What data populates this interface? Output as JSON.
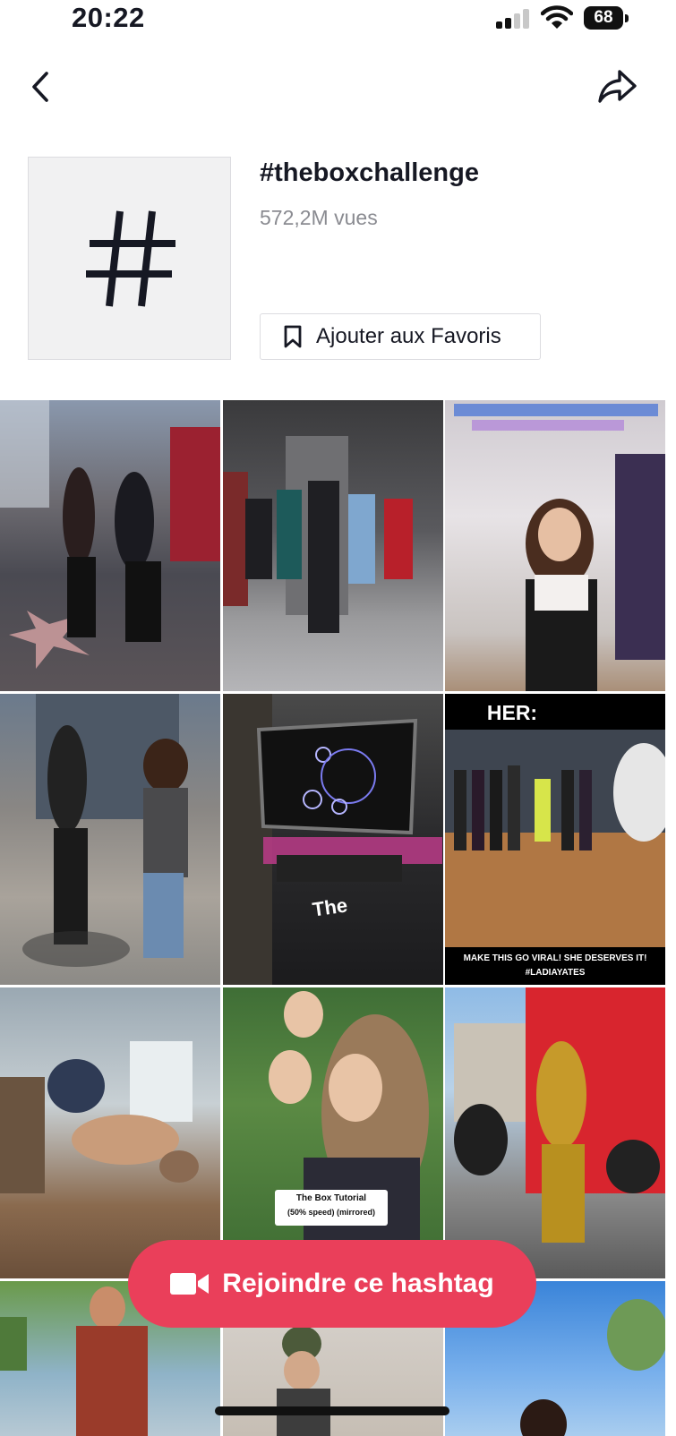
{
  "status_bar": {
    "time": "20:22",
    "battery": "68"
  },
  "nav": {
    "back_icon": "chevron-left-icon",
    "share_icon": "share-arrow-icon"
  },
  "hashtag": {
    "name": "#theboxchallenge",
    "views": "572,2M vues",
    "tile_icon": "hashtag-icon",
    "favorite_label": "Ajouter aux Favoris",
    "favorite_icon": "bookmark-icon"
  },
  "videos": [
    {
      "overlay": ""
    },
    {
      "overlay": ""
    },
    {
      "overlay": ""
    },
    {
      "overlay": ""
    },
    {
      "overlay": "The"
    },
    {
      "overlay_top": "HER:",
      "overlay_bottom": "MAKE THIS GO VIRAL! SHE DESERVES IT!",
      "overlay_tag": "#LADIAYATES"
    },
    {
      "overlay": ""
    },
    {
      "overlay_line1": "The Box Tutorial",
      "overlay_line2": "(50% speed) (mirrored)"
    },
    {
      "overlay": ""
    }
  ],
  "join": {
    "label": "Rejoindre ce hashtag",
    "icon": "video-camera-icon",
    "color": "#ea3f5a"
  }
}
